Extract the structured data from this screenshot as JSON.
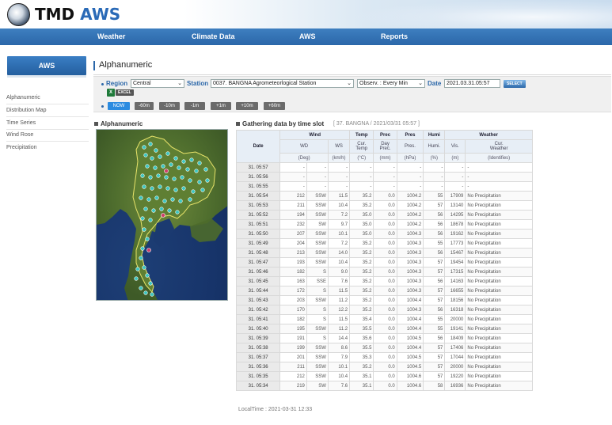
{
  "header": {
    "logo_text_1": "TMD",
    "logo_text_2": "AWS"
  },
  "nav": {
    "items": [
      {
        "label": "Weather"
      },
      {
        "label": "Climate Data"
      },
      {
        "label": "AWS"
      },
      {
        "label": "Reports"
      }
    ]
  },
  "sidebar": {
    "active_tab": "AWS",
    "items": [
      {
        "label": "Alphanumeric"
      },
      {
        "label": "Distribution Map"
      },
      {
        "label": "Time Series"
      },
      {
        "label": "Wind Rose"
      },
      {
        "label": "Precipitation"
      }
    ]
  },
  "page": {
    "title": "Alphanumeric"
  },
  "filters": {
    "region_label": "Region",
    "region_value": "Central",
    "station_label": "Station",
    "station_value": "0037. BANGNA Agrometeorlogical Station",
    "observ_value": "Observ. : Every Min",
    "date_label": "Date",
    "date_value": "2021.03.31.05:57",
    "select_button": "SELECT",
    "excel_label": "EXCEL",
    "time_buttons": [
      "NOW",
      "-60m",
      "-10m",
      "-1m",
      "+1m",
      "+10m",
      "+60m"
    ]
  },
  "map_section": {
    "title": "Alphanumeric"
  },
  "table_section": {
    "title": "Gathering data by time slot",
    "subtitle": "[ 37. BANGNA / 2021/03/31 05:57 ]"
  },
  "table": {
    "group_headers": {
      "date": "Date",
      "wind": "Wind",
      "temp": "Temp",
      "prec": "Prec",
      "pres": "Pres",
      "humi": "Humi",
      "weather": "Weather"
    },
    "sub_headers": {
      "wd": "WD",
      "ws": "WS",
      "cur_temp_1": "Cur.",
      "cur_temp_2": "Temp",
      "day_prec_1": "Day",
      "day_prec_2": "Prec.",
      "pres": "Pres.",
      "humi": "Humi.",
      "vis": "Vis.",
      "cur_wx_1": "Cur.",
      "cur_wx_2": "Weather"
    },
    "units": {
      "wd": "(Deg)",
      "ws": "(km/h)",
      "temp": "(°C)",
      "prec": "(mm)",
      "pres": "(hPa)",
      "humi": "(%)",
      "vis": "(m)",
      "wx": "(Identifies)"
    },
    "rows": [
      {
        "date": "31. 05:57",
        "wd": "-",
        "wdir": "-",
        "ws": "-",
        "temp": "-",
        "prec": "-",
        "pres": "-",
        "humi": "-",
        "vis": "-",
        "wx": "-"
      },
      {
        "date": "31. 05:56",
        "wd": "-",
        "wdir": "-",
        "ws": "-",
        "temp": "-",
        "prec": "-",
        "pres": "-",
        "humi": "-",
        "vis": "-",
        "wx": "-"
      },
      {
        "date": "31. 05:55",
        "wd": "-",
        "wdir": "-",
        "ws": "-",
        "temp": "-",
        "prec": "-",
        "pres": "-",
        "humi": "-",
        "vis": "-",
        "wx": "-"
      },
      {
        "date": "31. 05:54",
        "wd": "212",
        "wdir": "SSW",
        "ws": "11.5",
        "temp": "35.2",
        "prec": "0.0",
        "pres": "1004.2",
        "humi": "55",
        "vis": "17909",
        "wx": "No Precipitation"
      },
      {
        "date": "31. 05:53",
        "wd": "211",
        "wdir": "SSW",
        "ws": "10.4",
        "temp": "35.2",
        "prec": "0.0",
        "pres": "1004.2",
        "humi": "57",
        "vis": "13140",
        "wx": "No Precipitation"
      },
      {
        "date": "31. 05:52",
        "wd": "194",
        "wdir": "SSW",
        "ws": "7.2",
        "temp": "35.0",
        "prec": "0.0",
        "pres": "1004.2",
        "humi": "56",
        "vis": "14295",
        "wx": "No Precipitation"
      },
      {
        "date": "31. 05:51",
        "wd": "232",
        "wdir": "SW",
        "ws": "9.7",
        "temp": "35.0",
        "prec": "0.0",
        "pres": "1004.2",
        "humi": "56",
        "vis": "18678",
        "wx": "No Precipitation"
      },
      {
        "date": "31. 05:50",
        "wd": "207",
        "wdir": "SSW",
        "ws": "10.1",
        "temp": "35.0",
        "prec": "0.0",
        "pres": "1004.3",
        "humi": "56",
        "vis": "19162",
        "wx": "No Precipitation"
      },
      {
        "date": "31. 05:49",
        "wd": "204",
        "wdir": "SSW",
        "ws": "7.2",
        "temp": "35.2",
        "prec": "0.0",
        "pres": "1004.3",
        "humi": "55",
        "vis": "17773",
        "wx": "No Precipitation"
      },
      {
        "date": "31. 05:48",
        "wd": "213",
        "wdir": "SSW",
        "ws": "14.0",
        "temp": "35.2",
        "prec": "0.0",
        "pres": "1004.3",
        "humi": "56",
        "vis": "15467",
        "wx": "No Precipitation"
      },
      {
        "date": "31. 05:47",
        "wd": "193",
        "wdir": "SSW",
        "ws": "10.4",
        "temp": "35.2",
        "prec": "0.0",
        "pres": "1004.3",
        "humi": "57",
        "vis": "19454",
        "wx": "No Precipitation"
      },
      {
        "date": "31. 05:46",
        "wd": "182",
        "wdir": "S",
        "ws": "9.0",
        "temp": "35.2",
        "prec": "0.0",
        "pres": "1004.3",
        "humi": "57",
        "vis": "17315",
        "wx": "No Precipitation"
      },
      {
        "date": "31. 05:45",
        "wd": "163",
        "wdir": "SSE",
        "ws": "7.6",
        "temp": "35.2",
        "prec": "0.0",
        "pres": "1004.3",
        "humi": "56",
        "vis": "14163",
        "wx": "No Precipitation"
      },
      {
        "date": "31. 05:44",
        "wd": "172",
        "wdir": "S",
        "ws": "11.5",
        "temp": "35.2",
        "prec": "0.0",
        "pres": "1004.3",
        "humi": "57",
        "vis": "16655",
        "wx": "No Precipitation"
      },
      {
        "date": "31. 05:43",
        "wd": "203",
        "wdir": "SSW",
        "ws": "11.2",
        "temp": "35.2",
        "prec": "0.0",
        "pres": "1004.4",
        "humi": "57",
        "vis": "18156",
        "wx": "No Precipitation"
      },
      {
        "date": "31. 05:42",
        "wd": "170",
        "wdir": "S",
        "ws": "12.2",
        "temp": "35.2",
        "prec": "0.0",
        "pres": "1004.3",
        "humi": "56",
        "vis": "16318",
        "wx": "No Precipitation"
      },
      {
        "date": "31. 05:41",
        "wd": "182",
        "wdir": "S",
        "ws": "11.5",
        "temp": "35.4",
        "prec": "0.0",
        "pres": "1004.4",
        "humi": "55",
        "vis": "20000",
        "wx": "No Precipitation"
      },
      {
        "date": "31. 05:40",
        "wd": "195",
        "wdir": "SSW",
        "ws": "11.2",
        "temp": "35.5",
        "prec": "0.0",
        "pres": "1004.4",
        "humi": "55",
        "vis": "19141",
        "wx": "No Precipitation"
      },
      {
        "date": "31. 05:39",
        "wd": "191",
        "wdir": "S",
        "ws": "14.4",
        "temp": "35.6",
        "prec": "0.0",
        "pres": "1004.5",
        "humi": "56",
        "vis": "18409",
        "wx": "No Precipitation"
      },
      {
        "date": "31. 05:38",
        "wd": "199",
        "wdir": "SSW",
        "ws": "8.6",
        "temp": "35.5",
        "prec": "0.0",
        "pres": "1004.4",
        "humi": "57",
        "vis": "17406",
        "wx": "No Precipitation"
      },
      {
        "date": "31. 05:37",
        "wd": "201",
        "wdir": "SSW",
        "ws": "7.9",
        "temp": "35.3",
        "prec": "0.0",
        "pres": "1004.5",
        "humi": "57",
        "vis": "17044",
        "wx": "No Precipitation"
      },
      {
        "date": "31. 05:36",
        "wd": "211",
        "wdir": "SSW",
        "ws": "10.1",
        "temp": "35.2",
        "prec": "0.0",
        "pres": "1004.5",
        "humi": "57",
        "vis": "20000",
        "wx": "No Precipitation"
      },
      {
        "date": "31. 05:35",
        "wd": "212",
        "wdir": "SSW",
        "ws": "10.4",
        "temp": "35.1",
        "prec": "0.0",
        "pres": "1004.6",
        "humi": "57",
        "vis": "19220",
        "wx": "No Precipitation"
      },
      {
        "date": "31. 05:34",
        "wd": "219",
        "wdir": "SW",
        "ws": "7.6",
        "temp": "35.1",
        "prec": "0.0",
        "pres": "1004.6",
        "humi": "58",
        "vis": "16936",
        "wx": "No Precipitation"
      }
    ]
  },
  "footer": {
    "local_time": "LocalTime : 2021-03-31 12:33"
  }
}
